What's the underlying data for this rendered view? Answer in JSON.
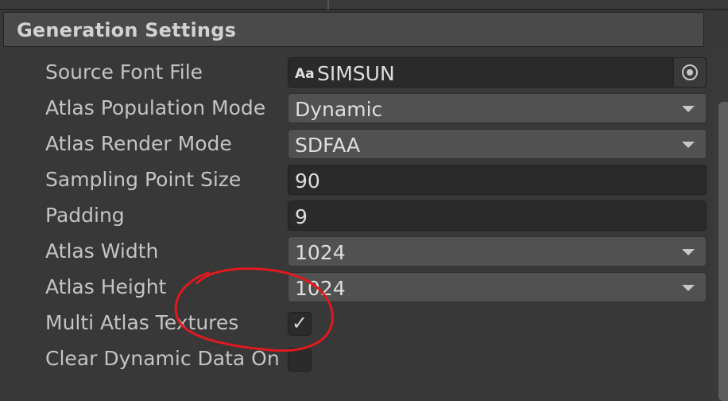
{
  "section": {
    "title": "Generation Settings"
  },
  "fields": {
    "source_font_file": {
      "label": "Source Font File",
      "icon": "Aa",
      "value": "SIMSUN"
    },
    "atlas_population_mode": {
      "label": "Atlas Population Mode",
      "value": "Dynamic"
    },
    "atlas_render_mode": {
      "label": "Atlas Render Mode",
      "value": "SDFAA"
    },
    "sampling_point_size": {
      "label": "Sampling Point Size",
      "value": "90"
    },
    "padding": {
      "label": "Padding",
      "value": "9"
    },
    "atlas_width": {
      "label": "Atlas Width",
      "value": "1024"
    },
    "atlas_height": {
      "label": "Atlas Height",
      "value": "1024"
    },
    "multi_atlas_textures": {
      "label": "Multi Atlas Textures",
      "checked": true,
      "check_glyph": "✓"
    },
    "clear_dynamic_data": {
      "label": "Clear Dynamic Data On",
      "checked": false
    }
  },
  "colors": {
    "background": "#383838",
    "header": "#4a4a4a",
    "text_field": "#2a2a2a",
    "dropdown": "#515151",
    "annotation": "#e0191f"
  }
}
